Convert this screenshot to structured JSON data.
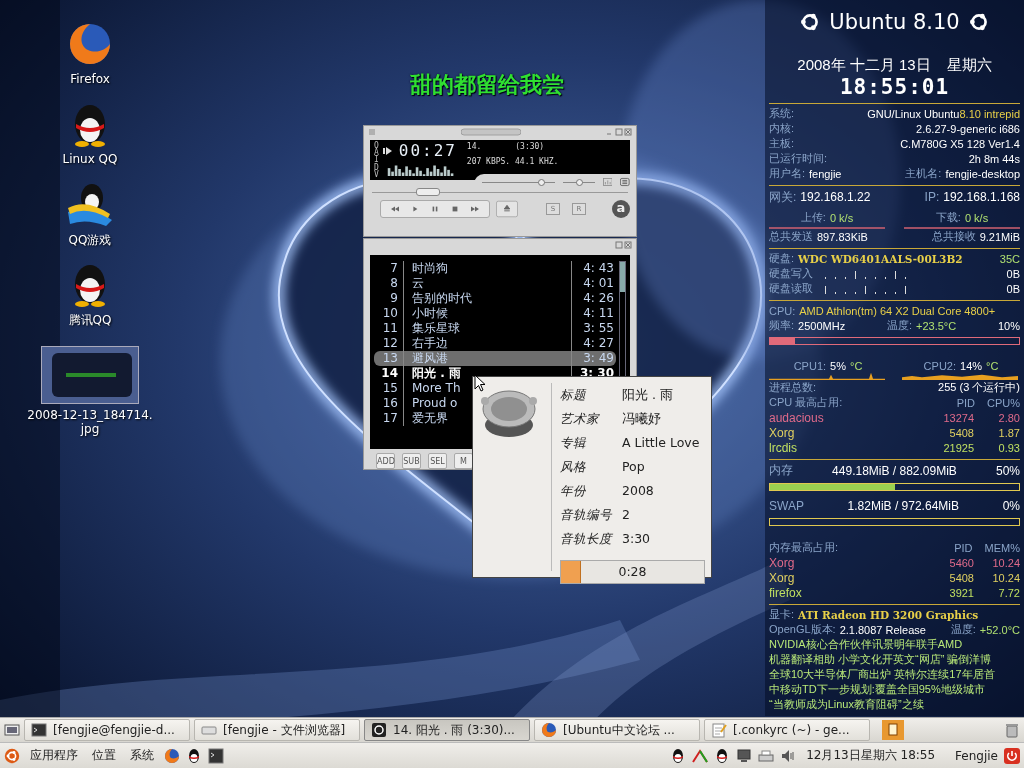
{
  "desktop_icons": [
    {
      "label": "Firefox",
      "kind": "globe"
    },
    {
      "label": "Linux QQ",
      "kind": "penguin"
    },
    {
      "label": "QQ游戏",
      "kind": "game"
    },
    {
      "label": "腾讯QQ",
      "kind": "penguin"
    },
    {
      "label": "2008-12-13_184714.jpg"
    }
  ],
  "lyric": "甜的都留给我尝",
  "player": {
    "clutterbar": [
      "O",
      "A",
      "I",
      "D",
      "V"
    ],
    "time": "00:27",
    "track": "14.",
    "duration": "(3:30)",
    "stream": "207 KBPS. 44.1 KHZ.",
    "volume": {
      "level": 0.8
    },
    "balance": {
      "level": 0.5
    },
    "seek": {
      "level": 0.22
    },
    "toggles": [
      "S",
      "R"
    ],
    "logo_letter": "a",
    "playlist": [
      {
        "number": "7",
        "title": "时尚狗",
        "length": "4: 43",
        "selected": false,
        "playing": false
      },
      {
        "number": "8",
        "title": "云",
        "length": "4: 01",
        "selected": false,
        "playing": false
      },
      {
        "number": "9",
        "title": "告别的时代",
        "length": "4: 26",
        "selected": false,
        "playing": false
      },
      {
        "number": "10",
        "title": "小时候",
        "length": "4: 11",
        "selected": false,
        "playing": false
      },
      {
        "number": "11",
        "title": "集乐星球",
        "length": "3: 55",
        "selected": false,
        "playing": false
      },
      {
        "number": "12",
        "title": "右手边",
        "length": "4: 27",
        "selected": false,
        "playing": false
      },
      {
        "number": "13",
        "title": "避风港",
        "length": "3: 49",
        "selected": true,
        "playing": false
      },
      {
        "number": "14",
        "title": "阳光 . 雨",
        "length": "3: 30",
        "selected": false,
        "playing": true
      },
      {
        "number": "15",
        "title": "More Th",
        "selected": false,
        "playing": false
      },
      {
        "number": "16",
        "title": "Proud o",
        "selected": false,
        "playing": false
      },
      {
        "number": "17",
        "title": "爱无界",
        "selected": false,
        "playing": false
      }
    ],
    "buttons": [
      "ADD",
      "SUB",
      "SEL",
      "M"
    ]
  },
  "tooltip": {
    "fields": [
      {
        "label": "标题",
        "value": "阳光 . 雨"
      },
      {
        "label": "艺术家",
        "value": "冯曦妤"
      },
      {
        "label": "专辑",
        "value": "A Little Love"
      },
      {
        "label": "风格",
        "value": "Pop"
      },
      {
        "label": "年份",
        "value": "2008"
      },
      {
        "label": "音轨编号",
        "value": "2"
      },
      {
        "label": "音轨长度",
        "value": "3:30"
      }
    ],
    "progress": {
      "level": 0.13,
      "text": "0:28"
    }
  },
  "conky": {
    "title": "Ubuntu 8.10",
    "date": "2008年 十二月 13日",
    "weekday": "星期六",
    "clock": "18:55:01",
    "system": [
      {
        "label": "系统:",
        "value": "GNU/Linux Ubuntu",
        "accent": "8.10 intrepid"
      },
      {
        "label": "内核:",
        "value": "2.6.27-9-generic i686"
      },
      {
        "label": "主板:",
        "value": "C.M780G X5 128  Ver1.4"
      },
      {
        "label": "已运行时间:",
        "value": "2h 8m 44s"
      }
    ],
    "user": {
      "label": "用户名:",
      "value": "fengjie",
      "host_label": "主机名:",
      "host": "fengjie-desktop"
    },
    "network": {
      "gateway_label": "网关:",
      "gateway": "192.168.1.22",
      "ip_label": "IP:",
      "ip": "192.168.1.168",
      "up_label": "上传:",
      "up": "0 k/s",
      "down_label": "下载:",
      "down": "0 k/s",
      "sent_label": "总共发送",
      "sent": "897.83KiB",
      "recv_label": "总共接收",
      "recv": "9.21MiB"
    },
    "disk": {
      "label": "硬盘:",
      "model": "WDC WD6401AALS-00L3B2",
      "temp": "35C",
      "rows": [
        {
          "label": "硬盘写入",
          "value": "0B"
        },
        {
          "label": "硬盘读取",
          "value": "0B"
        }
      ]
    },
    "cpu": {
      "label": "CPU:",
      "model": "AMD Athlon(tm) 64 X2 Dual Core 4800+",
      "freq_label": "频率:",
      "freq": "2500MHz",
      "temp_label": "温度:",
      "temp": "+23.5°C",
      "usage": "10%",
      "level": 0.1,
      "cores": [
        {
          "label": "CPU1:",
          "value": "5%",
          "unit": "°C"
        },
        {
          "label": "CPU2:",
          "value": "14%",
          "unit": "°C"
        }
      ],
      "procs_label": "进程总数:",
      "procs": "255 (3 个运行中)",
      "top_label": "CPU 最高占用:",
      "col_pid": "PID",
      "col_usage": "CPU%",
      "top": [
        {
          "name": "audacious",
          "pid": "13274",
          "usage": "2.80",
          "color": "#e06a8a"
        },
        {
          "name": "Xorg",
          "pid": "5408",
          "usage": "1.87",
          "color": "#e0d060"
        },
        {
          "name": "lrcdis",
          "pid": "21925",
          "usage": "0.93",
          "color": "#c0e060"
        }
      ]
    },
    "memory": [
      {
        "label": "内存",
        "value": "449.18MiB / 882.09MiB",
        "percent": "50%",
        "level": 0.5
      },
      {
        "label": "SWAP",
        "value": "1.82MiB / 972.64MiB",
        "percent": "0%",
        "level": 0
      }
    ],
    "mem_top": {
      "label": "内存最高占用:",
      "col_pid": "PID",
      "col_usage": "MEM%",
      "rows": [
        {
          "name": "Xorg",
          "pid": "5460",
          "usage": "10.24",
          "color": "#e06a8a"
        },
        {
          "name": "Xorg",
          "pid": "5408",
          "usage": "10.24",
          "color": "#e0d060"
        },
        {
          "name": "firefox",
          "pid": "3921",
          "usage": "7.72",
          "color": "#c0e060"
        }
      ]
    },
    "gpu": {
      "label": "显卡:",
      "model": "ATI Radeon HD 3200 Graphics",
      "gl_label": "OpenGL版本:",
      "gl": "2.1.8087 Release",
      "temp_label": "温度:",
      "temp": "+52.0°C"
    },
    "news": [
      "NVIDIA核心合作伙伴讯景明年联手AMD",
      "机器翻译相助 小学文化开英文“网店” 骗倒洋博",
      "全球10大半导体厂商出炉 英特尔连续17年居首",
      "中移动TD下一步规划:覆盖全国95%地级城市",
      "“当教师成为Linux教育阻碍”之续"
    ]
  },
  "taskbar": {
    "tasks": [
      {
        "label": "[fengjie@fengjie-d...",
        "kind": "terminal",
        "selected": false
      },
      {
        "label": "[fengjie - 文件浏览器]",
        "kind": "files",
        "selected": false
      },
      {
        "label": "14. 阳光 . 雨 (3:30)...",
        "kind": "player",
        "selected": true
      },
      {
        "label": "[Ubuntu中文论坛 ...",
        "kind": "globe",
        "selected": false
      },
      {
        "label": "[.conkyrc (~) - ge...",
        "kind": "editor",
        "selected": false
      }
    ],
    "menus": [
      "应用程序",
      "位置",
      "系统"
    ],
    "launchers": [
      {
        "kind": "globe"
      },
      {
        "kind": "penguin"
      },
      {
        "kind": "terminal"
      }
    ],
    "clock": "12月13日星期六 18:55",
    "user": "Fengjie"
  }
}
